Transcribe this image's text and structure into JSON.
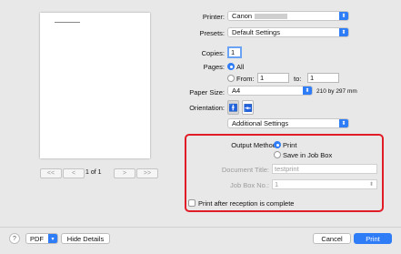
{
  "preview": {
    "pager_first": "<<",
    "pager_prev": "<",
    "page_indicator": "1 of 1",
    "pager_next": ">",
    "pager_last": ">>"
  },
  "printer": {
    "label": "Printer:",
    "value": "Canon"
  },
  "presets": {
    "label": "Presets:",
    "value": "Default Settings"
  },
  "copies": {
    "label": "Copies:",
    "value": "1"
  },
  "pages": {
    "label": "Pages:",
    "all_label": "All",
    "from_label": "From:",
    "from_value": "1",
    "to_label": "to:",
    "to_value": "1",
    "selected": "All"
  },
  "paper_size": {
    "label": "Paper Size:",
    "value": "A4",
    "dimensions": "210 by 297 mm"
  },
  "orientation": {
    "label": "Orientation:",
    "selected": "portrait"
  },
  "section_popup": {
    "value": "Additional Settings"
  },
  "additional": {
    "output_method_label": "Output Method:",
    "print_option": "Print",
    "save_option": "Save in Job Box",
    "selected": "Print",
    "doc_title_label": "Document Title:",
    "doc_title_value": "testprint",
    "job_box_label": "Job Box No.:",
    "job_box_value": "1",
    "print_after_label": "Print after reception is complete",
    "print_after_checked": false
  },
  "footer": {
    "help": "?",
    "pdf_label": "PDF",
    "hide_details_label": "Hide Details",
    "cancel_label": "Cancel",
    "print_label": "Print"
  },
  "colors": {
    "accent": "#2e7cf6",
    "highlight_box": "#e21c27"
  }
}
